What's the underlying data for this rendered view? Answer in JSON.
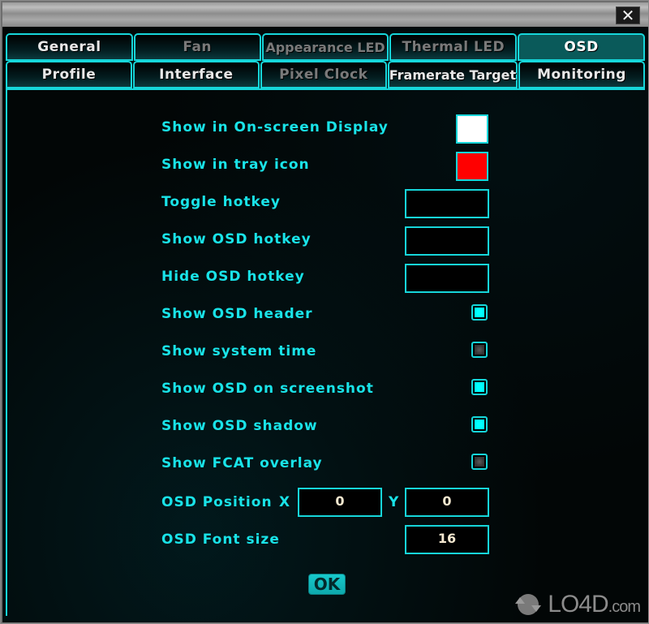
{
  "window": {
    "close_icon": "✕"
  },
  "tabs": {
    "row1": [
      {
        "label": "General",
        "state": "normal"
      },
      {
        "label": "Fan",
        "state": "disabled"
      },
      {
        "label": "Appearance LED",
        "state": "disabled"
      },
      {
        "label": "Thermal LED",
        "state": "disabled"
      },
      {
        "label": "OSD",
        "state": "active"
      }
    ],
    "row2": [
      {
        "label": "Profile",
        "state": "normal"
      },
      {
        "label": "Interface",
        "state": "normal"
      },
      {
        "label": "Pixel Clock",
        "state": "disabled"
      },
      {
        "label": "Framerate Target",
        "state": "normal"
      },
      {
        "label": "Monitoring",
        "state": "normal"
      }
    ]
  },
  "osd": {
    "show_in_osd": {
      "label": "Show in On-screen Display",
      "color": "#ffffff"
    },
    "show_in_tray": {
      "label": "Show in tray icon",
      "color": "#ff0000"
    },
    "toggle_hotkey": {
      "label": "Toggle hotkey",
      "value": ""
    },
    "show_osd_hotkey": {
      "label": "Show OSD hotkey",
      "value": ""
    },
    "hide_osd_hotkey": {
      "label": "Hide OSD hotkey",
      "value": ""
    },
    "checkboxes": [
      {
        "label": "Show OSD header",
        "checked": true
      },
      {
        "label": "Show system time",
        "checked": false
      },
      {
        "label": "Show OSD on screenshot",
        "checked": true
      },
      {
        "label": "Show OSD shadow",
        "checked": true
      },
      {
        "label": "Show FCAT overlay",
        "checked": false
      }
    ],
    "position": {
      "label": "OSD Position",
      "x_label": "X",
      "x_value": "0",
      "y_label": "Y",
      "y_value": "0"
    },
    "font_size": {
      "label": "OSD Font size",
      "value": "16"
    },
    "ok_label": "OK"
  },
  "watermark": {
    "text": "LO4D",
    "suffix": ".com"
  }
}
